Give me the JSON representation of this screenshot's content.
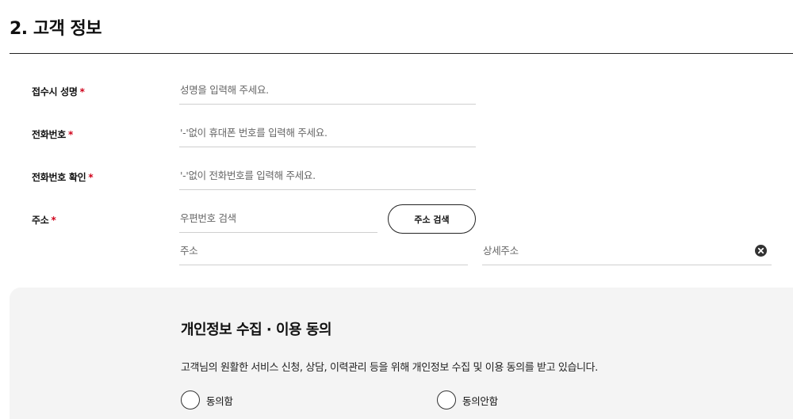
{
  "section": {
    "title": "2. 고객 정보"
  },
  "form": {
    "name": {
      "label": "접수시 성명",
      "required_mark": "*",
      "placeholder": "성명을 입력해 주세요."
    },
    "phone": {
      "label": "전화번호",
      "required_mark": "*",
      "placeholder": "'-'없이 휴대폰 번호를 입력해 주세요."
    },
    "phone_confirm": {
      "label": "전화번호 확인",
      "required_mark": "*",
      "placeholder": "'-'없이 전화번호를 입력해 주세요."
    },
    "address": {
      "label": "주소",
      "required_mark": "*",
      "postcode_placeholder": "우편번호 검색",
      "search_button": "주소 검색",
      "address_placeholder": "주소",
      "detail_placeholder": "상세주소"
    }
  },
  "consent": {
    "title": "개인정보 수집 · 이용 동의",
    "description": "고객님의 원활한 서비스 신청, 상담, 이력관리 등을 위해 개인정보 수집 및 이용 동의를 받고 있습니다.",
    "options": [
      {
        "label": "동의함",
        "selected": false
      },
      {
        "label": "동의안함",
        "selected": false
      }
    ]
  }
}
